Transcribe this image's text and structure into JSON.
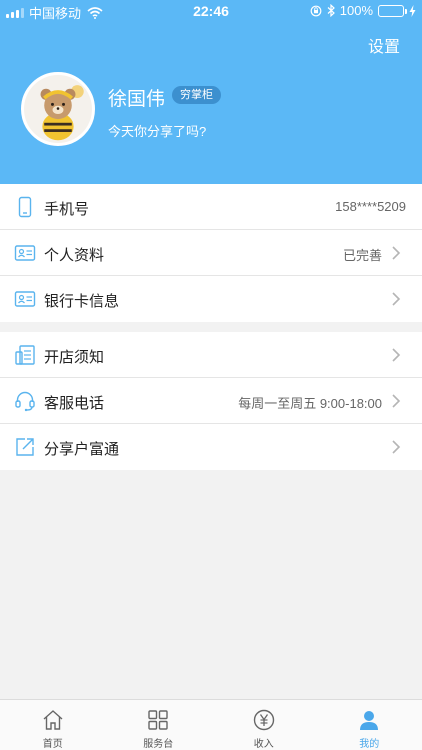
{
  "statusbar": {
    "carrier": "中国移动",
    "time": "22:46",
    "battery": "100%"
  },
  "header": {
    "settings_label": "设置",
    "user_name": "徐国伟",
    "user_badge": "穷掌柜",
    "slogan": "今天你分享了吗?"
  },
  "list1": [
    {
      "label": "手机号",
      "value": "158****5209",
      "icon": "phone-icon"
    },
    {
      "label": "个人资料",
      "value": "已完善",
      "icon": "id-card-icon"
    },
    {
      "label": "银行卡信息",
      "value": "",
      "icon": "bank-card-icon"
    }
  ],
  "list2": [
    {
      "label": "开店须知",
      "value": "",
      "icon": "notice-icon"
    },
    {
      "label": "客服电话",
      "value": "每周一至周五 9:00-18:00",
      "icon": "headset-icon"
    },
    {
      "label": "分享户富通",
      "value": "",
      "icon": "share-icon"
    }
  ],
  "tabbar": [
    {
      "label": "首页",
      "icon": "home-icon"
    },
    {
      "label": "服务台",
      "icon": "grid-icon"
    },
    {
      "label": "收入",
      "icon": "yuan-icon"
    },
    {
      "label": "我的",
      "icon": "user-icon",
      "active": true
    }
  ],
  "colors": {
    "header_bg": "#5bb8f6",
    "accent": "#4aa7ea",
    "badge_bg": "#3c90cf"
  }
}
